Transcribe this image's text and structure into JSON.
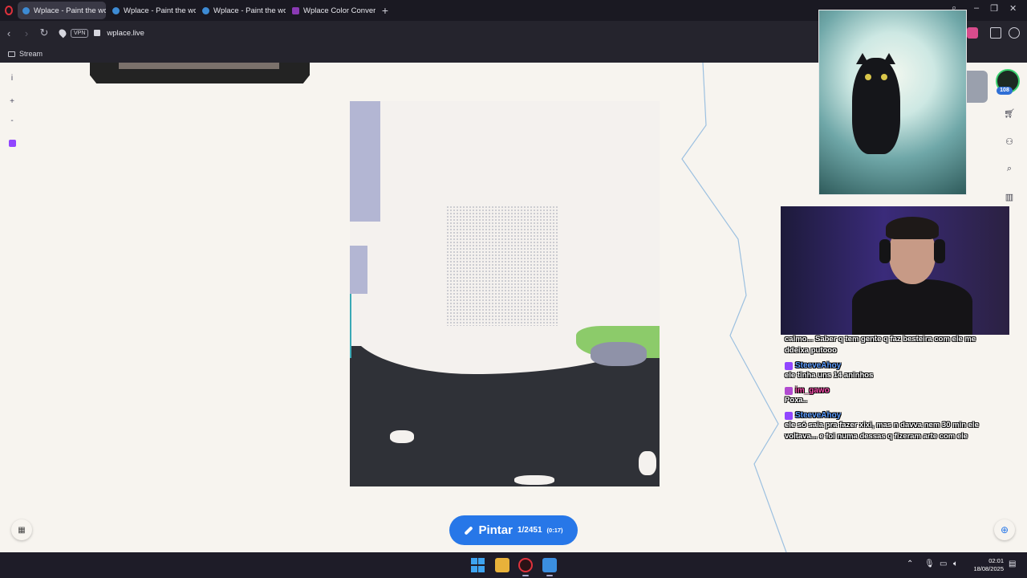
{
  "browser": {
    "tabs": [
      {
        "label": "Wplace - Paint the world",
        "active": true
      },
      {
        "label": "Wplace - Paint the world",
        "active": false
      },
      {
        "label": "Wplace - Paint the world",
        "active": false
      },
      {
        "label": "Wplace Color Converter",
        "active": false
      }
    ],
    "new_tab_glyph": "+",
    "address": {
      "vpn_label": "VPN",
      "url": "wplace.live"
    },
    "bookmarks": [
      {
        "label": "Stream"
      }
    ]
  },
  "page": {
    "left_tools": {
      "info": "i",
      "zoom_in": "+",
      "zoom_out": "-"
    },
    "paint_button": {
      "label": "Pintar",
      "count": "1/2451",
      "timer": "(0:17)"
    },
    "user": {
      "level": "108"
    },
    "colors": {
      "accent": "#2777e8",
      "background": "#f7f4ef",
      "art_dark": "#2f3137",
      "art_green": "#8ccb6a",
      "art_lavender": "#b3b6d3",
      "badge_green": "#3bd16f"
    }
  },
  "chat": {
    "messages": [
      {
        "user": "",
        "text": "calmo... Saber q tem gente q faz besteira com ele me ddeixa putooo"
      },
      {
        "user": "SteeveAhoy",
        "user_color": "#5b9cff",
        "text": "ele tinha uns 14 aninhos"
      },
      {
        "user": "im_gawo",
        "user_color": "#ff4fb0",
        "text": "Poxa.."
      },
      {
        "user": "SteeveAhoy",
        "user_color": "#5b9cff",
        "text": "ele só saia pra fazer xixi, mas n davva nem 30 min ele voltava... e foi numa dessas q fizeram arte com ele"
      }
    ]
  },
  "taskbar": {
    "time": "02:01",
    "date": "18/08/2025"
  }
}
